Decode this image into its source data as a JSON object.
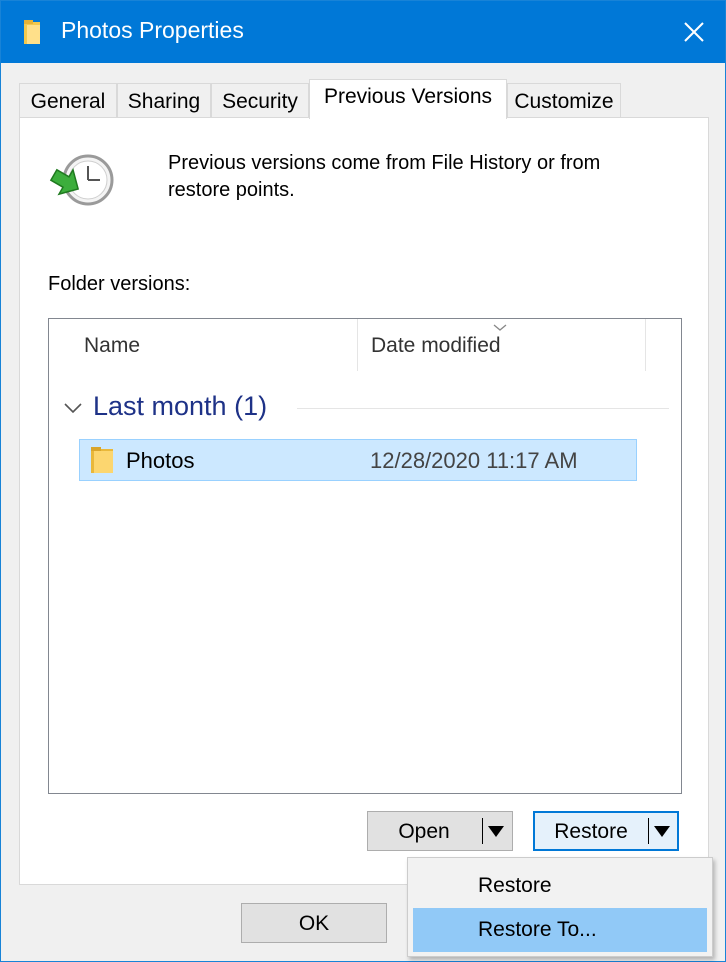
{
  "window": {
    "title": "Photos Properties",
    "accent_color": "#0078d7",
    "title_icon": "folder-icon",
    "close_icon": "close-icon"
  },
  "tabs": [
    {
      "label": "General",
      "active": false
    },
    {
      "label": "Sharing",
      "active": false
    },
    {
      "label": "Security",
      "active": false
    },
    {
      "label": "Previous Versions",
      "active": true
    },
    {
      "label": "Customize",
      "active": false
    }
  ],
  "panel": {
    "icon": "clock-restore-icon",
    "intro": "Previous versions come from File History or from restore points.",
    "folder_versions_label": "Folder versions:"
  },
  "list": {
    "columns": [
      "Name",
      "Date modified"
    ],
    "sorted_column": "Date modified",
    "group": {
      "label": "Last month (1)",
      "expanded": true
    },
    "rows": [
      {
        "icon": "folder-icon",
        "name": "Photos",
        "date": "12/28/2020 11:17 AM",
        "selected": true
      }
    ]
  },
  "buttons": {
    "open": "Open",
    "restore": "Restore",
    "ok": "OK"
  },
  "restore_menu": {
    "items": [
      {
        "label": "Restore",
        "highlighted": false
      },
      {
        "label": "Restore To...",
        "highlighted": true
      }
    ]
  }
}
